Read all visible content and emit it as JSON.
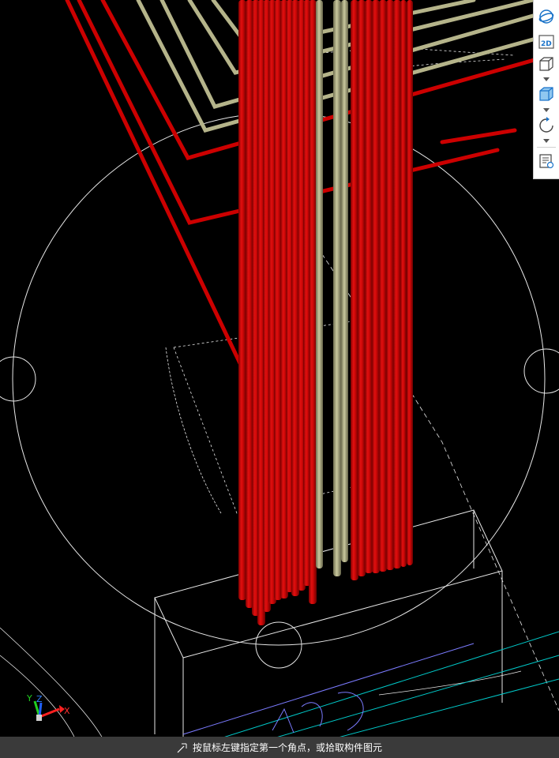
{
  "toolbar": {
    "buttons": [
      {
        "name": "orbit-view-icon"
      },
      {
        "name": "view-2d-icon",
        "label": "2D"
      },
      {
        "name": "wireframe-cube-icon"
      },
      {
        "name": "shaded-cube-icon"
      },
      {
        "name": "rotate-icon"
      },
      {
        "name": "list-settings-icon"
      }
    ]
  },
  "status": {
    "message": "按鼠标左键指定第一个角点，或拾取构件图元"
  },
  "axis": {
    "x_label": "X",
    "y_label": "Y",
    "z_label": "Z"
  },
  "colors": {
    "rebar_red": "#cc0000",
    "rebar_khaki": "#b5b48a",
    "wire": "#ffffff",
    "cyan_line": "#00c8c8",
    "blue_line": "#7b7bff",
    "toolbar_accent": "#1a73c9"
  }
}
